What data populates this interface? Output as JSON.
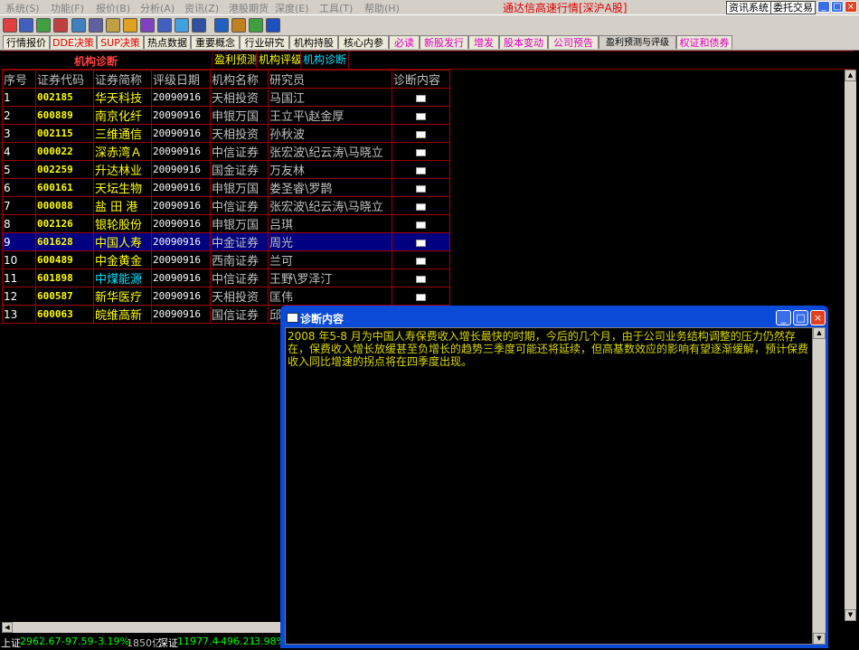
{
  "menubar": {
    "items": [
      "系统(S)",
      "功能(F)",
      "报价(B)",
      "分析(A)",
      "资讯(Z)",
      "港股期货",
      "深度(E)",
      "工具(T)",
      "帮助(H)"
    ],
    "title": "通达信高速行情[深沪A股]",
    "btn_info": "资讯系统",
    "btn_trade": "委托交易"
  },
  "tabs": [
    {
      "label": "行情报价"
    },
    {
      "label": "DDE决策"
    },
    {
      "label": "SUP决策"
    },
    {
      "label": "热点数据"
    },
    {
      "label": "重要概念"
    },
    {
      "label": "行业研究"
    },
    {
      "label": "机构持股"
    },
    {
      "label": "核心内参"
    },
    {
      "label": "必读"
    },
    {
      "label": "新股发行"
    },
    {
      "label": "增发"
    },
    {
      "label": "股本变动"
    },
    {
      "label": "公司预告"
    },
    {
      "label": "盈利预测与评级"
    },
    {
      "label": "权证和债券"
    }
  ],
  "subheader": {
    "main": "机构诊断",
    "tabs": [
      "盈利预测",
      "机构评级",
      "机构诊断"
    ]
  },
  "table": {
    "headers": [
      "序号",
      "证券代码",
      "证券简称",
      "评级日期",
      "机构名称",
      "研究员",
      "诊断内容"
    ],
    "rows": [
      {
        "no": "1",
        "code": "002185",
        "name": "华天科技",
        "date": "20090916",
        "org": "天相投资",
        "researcher": "马国江"
      },
      {
        "no": "2",
        "code": "600889",
        "name": "南京化纤",
        "date": "20090916",
        "org": "申银万国",
        "researcher": "王立平\\赵金厚"
      },
      {
        "no": "3",
        "code": "002115",
        "name": "三维通信",
        "date": "20090916",
        "org": "天相投资",
        "researcher": "孙秋波"
      },
      {
        "no": "4",
        "code": "000022",
        "name": "深赤湾Ａ",
        "date": "20090916",
        "org": "中信证券",
        "researcher": "张宏波\\纪云涛\\马晓立"
      },
      {
        "no": "5",
        "code": "002259",
        "name": "升达林业",
        "date": "20090916",
        "org": "国金证券",
        "researcher": "万友林"
      },
      {
        "no": "6",
        "code": "600161",
        "name": "天坛生物",
        "date": "20090916",
        "org": "申银万国",
        "researcher": "娄圣睿\\罗鹊"
      },
      {
        "no": "7",
        "code": "000088",
        "name": "盐 田 港",
        "date": "20090916",
        "org": "中信证券",
        "researcher": "张宏波\\纪云涛\\马晓立"
      },
      {
        "no": "8",
        "code": "002126",
        "name": "银轮股份",
        "date": "20090916",
        "org": "申银万国",
        "researcher": "吕琪"
      },
      {
        "no": "9",
        "code": "601628",
        "name": "中国人寿",
        "date": "20090916",
        "org": "中金证券",
        "researcher": "周光"
      },
      {
        "no": "10",
        "code": "600489",
        "name": "中金黄金",
        "date": "20090916",
        "org": "西南证券",
        "researcher": "兰可"
      },
      {
        "no": "11",
        "code": "601898",
        "name": "中煤能源",
        "date": "20090916",
        "org": "中信证券",
        "researcher": "王野\\罗泽汀"
      },
      {
        "no": "12",
        "code": "600587",
        "name": "新华医疗",
        "date": "20090916",
        "org": "天相投资",
        "researcher": "匡伟"
      },
      {
        "no": "13",
        "code": "600063",
        "name": "皖维高新",
        "date": "20090916",
        "org": "国信证券",
        "researcher": "邱伟\\张栋梁"
      }
    ]
  },
  "popup": {
    "title": "诊断内容",
    "text": "2008 年5-8 月为中国人寿保费收入增长最快的时期，今后的几个月，由于公司业务结构调整的压力仍然存在，保费收入增长放缓甚至负增长的趋势三季度可能还将延续，但高基数效应的影响有望逐渐缓解，预计保费收入同比增速的拐点将在四季度出现。"
  },
  "statusbar": {
    "sh_label": "上证",
    "sh_value": "2962.67",
    "sh_change": "-97.59",
    "sh_pct": "-3.19%",
    "sh_amount": "1850亿",
    "sz_label": "深证",
    "sz_value": "11977.4",
    "sz_change": "-496.21",
    "sz_pct": "-3.98%"
  },
  "colors": {
    "selected_row": "#000080",
    "cyan_name": "#00e0ff",
    "grid_line": "#a00000"
  }
}
